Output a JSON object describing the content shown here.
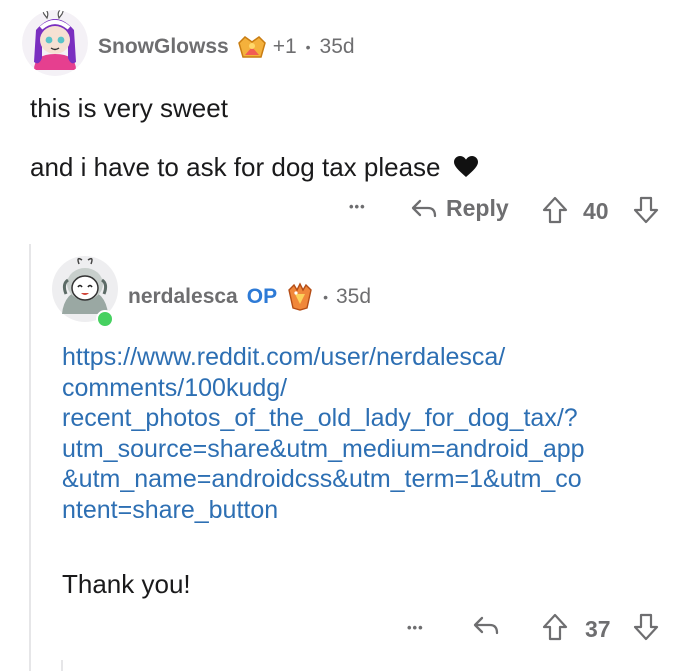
{
  "comment": {
    "username": "SnowGlowss",
    "karma_delta": "+1",
    "separator": "•",
    "age": "35d",
    "lines": [
      "this is very sweet",
      "and i have to ask for dog tax please"
    ],
    "more_label": "•••",
    "reply_label": "Reply",
    "votes": "40"
  },
  "reply": {
    "username": "nerdalesca",
    "op_label": "OP",
    "separator": "•",
    "age": "35d",
    "link_lines": [
      "https://www.reddit.com/user/nerdalesca/",
      "comments/100kudg/",
      "recent_photos_of_the_old_lady_for_dog_tax/?",
      "utm_source=share&utm_medium=android_app",
      "&utm_name=androidcss&utm_term=1&utm_co",
      "ntent=share_button"
    ],
    "message": "Thank you!",
    "more_label": "•••",
    "votes": "37"
  },
  "colors": {
    "link": "#2d6fb3",
    "meta": "#6e6e70",
    "op": "#2d7ad6",
    "online": "#46d160"
  }
}
